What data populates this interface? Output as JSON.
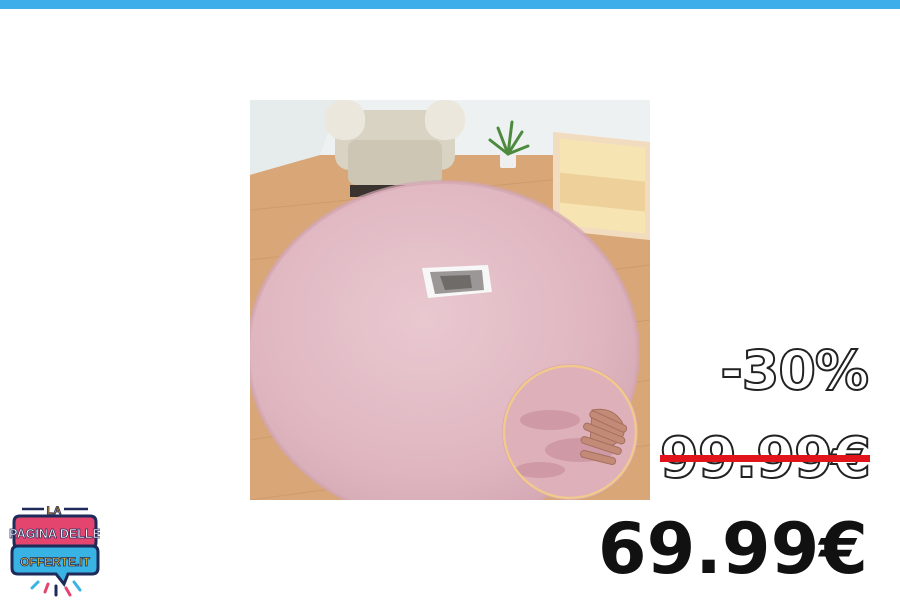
{
  "product": {
    "image_alt": "pink round fluffy rug"
  },
  "price": {
    "discount": "-30%",
    "old_price": "99.99€",
    "new_price": "69.99€"
  },
  "logo": {
    "line1": "LA",
    "line2": "PAGINA DELLE",
    "line3": "OFFERTE.IT"
  },
  "colors": {
    "top_bar": "#3daee9",
    "strike": "#e2141b",
    "rug": "#e3bfc8"
  }
}
